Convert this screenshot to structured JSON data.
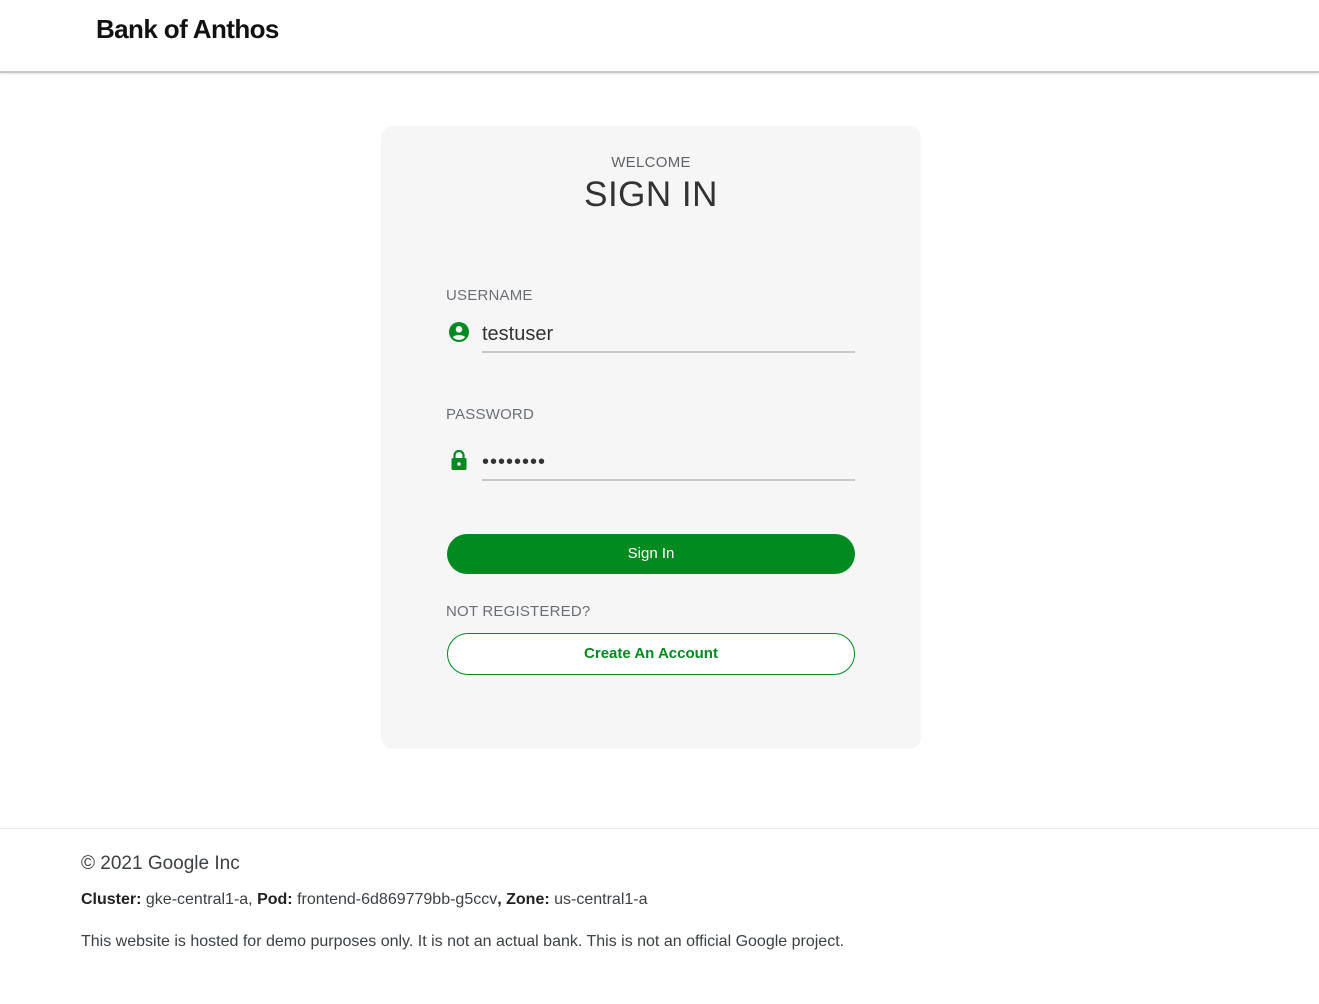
{
  "header": {
    "brand": "Bank of Anthos"
  },
  "login": {
    "welcome": "WELCOME",
    "title": "SIGN IN",
    "username_label": "USERNAME",
    "username_value": "testuser",
    "password_label": "PASSWORD",
    "password_value": "••••••••",
    "signin_button": "Sign In",
    "not_registered": "NOT REGISTERED?",
    "create_account_button": "Create An Account"
  },
  "footer": {
    "copyright": "© 2021 Google Inc",
    "cluster_label": "Cluster:",
    "cluster_value": "gke-central1-a,",
    "pod_label": "Pod:",
    "pod_value": "frontend-6d869779bb-g5ccv",
    "zone_label": ", Zone:",
    "zone_value": "us-central1-a",
    "disclaimer": "This website is hosted for demo purposes only. It is not an actual bank. This is not an official Google project."
  },
  "icons": {
    "username": "account-circle-icon",
    "password": "lock-icon"
  },
  "colors": {
    "accent": "#008a20",
    "card_background": "#f6f6f6"
  }
}
